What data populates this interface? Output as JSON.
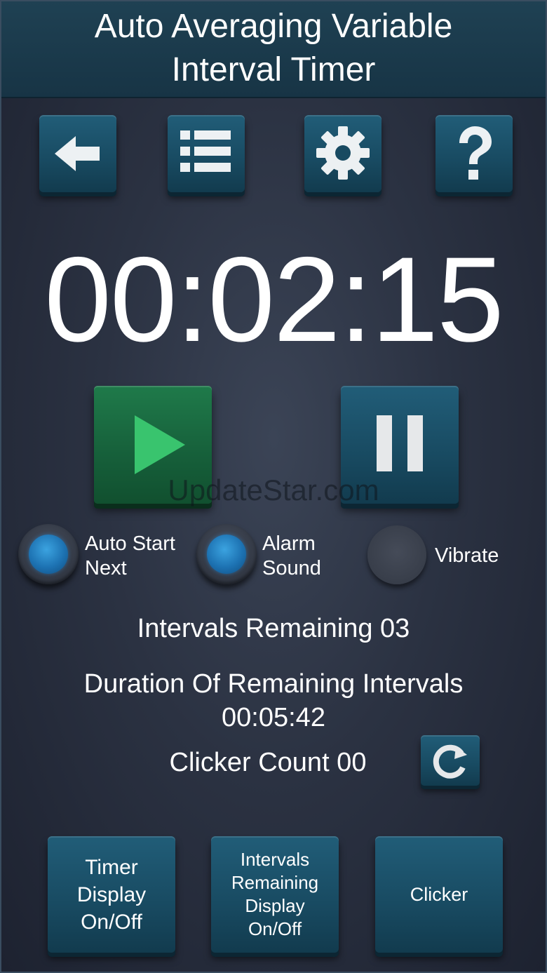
{
  "header": {
    "title_line1": "Auto Averaging Variable",
    "title_line2": "Interval Timer"
  },
  "toolbar": {
    "buttons": [
      {
        "name": "back",
        "icon": "arrow-left-icon"
      },
      {
        "name": "list",
        "icon": "list-icon"
      },
      {
        "name": "settings",
        "icon": "gear-icon"
      },
      {
        "name": "help",
        "icon": "question-icon"
      }
    ]
  },
  "timer": {
    "display": "00:02:15"
  },
  "controls": {
    "play_icon": "play-icon",
    "pause_icon": "pause-icon"
  },
  "watermark": "UpdateStar.com",
  "toggles": [
    {
      "line1": "Auto Start",
      "line2": "Next",
      "on": true
    },
    {
      "line1": "Alarm",
      "line2": "Sound",
      "on": true
    },
    {
      "line1": "Vibrate",
      "line2": "",
      "on": false
    }
  ],
  "status": {
    "intervals_remaining": "Intervals Remaining 03",
    "duration_label": "Duration Of Remaining Intervals",
    "duration_value": "00:05:42",
    "clicker_count": "Clicker Count 00"
  },
  "bottom_buttons": [
    {
      "label": "Timer\nDisplay\nOn/Off"
    },
    {
      "label": "Intervals\nRemaining\nDisplay\nOn/Off"
    },
    {
      "label": "Clicker"
    }
  ],
  "colors": {
    "button_blue": "#184a61",
    "play_green": "#165f3a",
    "play_icon_green": "#39c46e",
    "led_blue": "#1d72b2"
  }
}
